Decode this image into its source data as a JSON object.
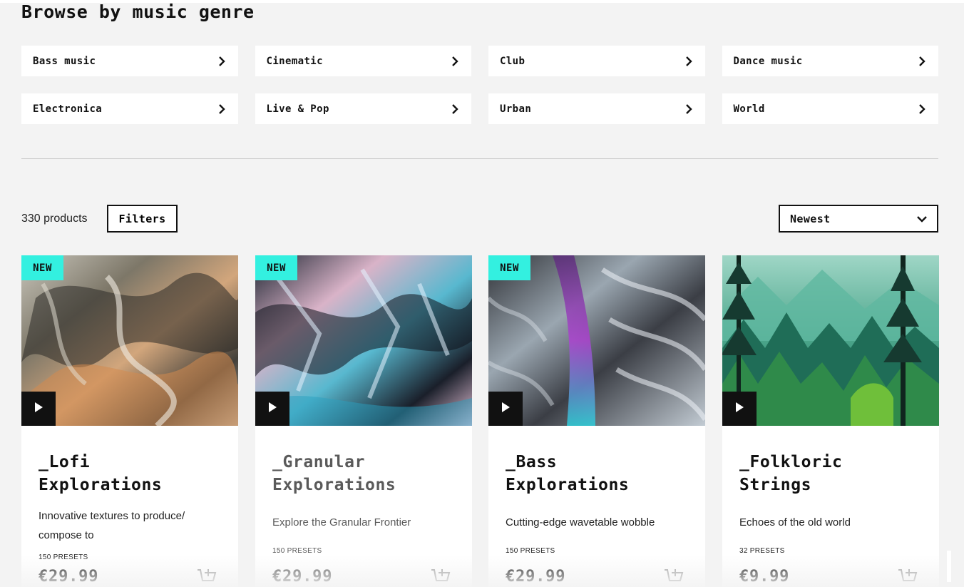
{
  "page": {
    "title": "Browse by music genre"
  },
  "genres": [
    {
      "label": "Bass music"
    },
    {
      "label": "Cinematic"
    },
    {
      "label": "Club"
    },
    {
      "label": "Dance music"
    },
    {
      "label": "Electronica"
    },
    {
      "label": "Live & Pop"
    },
    {
      "label": "Urban"
    },
    {
      "label": "World"
    }
  ],
  "toolbar": {
    "product_count": "330 products",
    "filters_label": "Filters",
    "sort_selected": "Newest"
  },
  "products": [
    {
      "badge": "NEW",
      "title": "_Lofi Explorations",
      "description": "Innovative textures to produce/ compose to",
      "presets": "150 PRESETS",
      "price": "€29.99"
    },
    {
      "badge": "NEW",
      "title": "_Granular Explorations",
      "description": "Explore the Granular Frontier",
      "presets": "150 PRESETS",
      "price": "€29.99"
    },
    {
      "badge": "NEW",
      "title": "_Bass Explorations",
      "description": "Cutting-edge wavetable wobble",
      "presets": "150 PRESETS",
      "price": "€29.99"
    },
    {
      "badge": "",
      "title": "_Folkloric Strings",
      "description": "Echoes of the old world",
      "presets": "32 PRESETS",
      "price": "€9.99"
    }
  ],
  "colors": {
    "badge": "#33f0e0",
    "background": "#f3f3f3",
    "text": "#111111"
  },
  "icons": {
    "genre_arrow": "chevron-right-icon",
    "sort_arrow": "chevron-down-icon",
    "play": "play-icon",
    "cart": "add-to-cart-icon"
  }
}
